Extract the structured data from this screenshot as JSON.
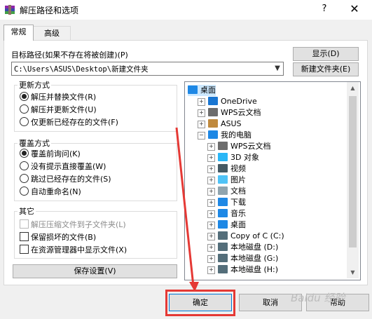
{
  "window": {
    "title": "解压路径和选项",
    "help": "?",
    "close": "✕"
  },
  "tabs": [
    {
      "label": "常规",
      "active": true
    },
    {
      "label": "高级",
      "active": false
    }
  ],
  "destination": {
    "label": "目标路径(如果不存在将被创建)(P)",
    "value": "C:\\Users\\ASUS\\Desktop\\新建文件夹",
    "show_button": "显示(D)",
    "new_folder_button": "新建文件夹(E)"
  },
  "update_mode": {
    "legend": "更新方式",
    "options": [
      {
        "label": "解压并替换文件(R)",
        "selected": true
      },
      {
        "label": "解压并更新文件(U)",
        "selected": false
      },
      {
        "label": "仅更新已经存在的文件(F)",
        "selected": false
      }
    ]
  },
  "overwrite_mode": {
    "legend": "覆盖方式",
    "options": [
      {
        "label": "覆盖前询问(K)",
        "selected": true
      },
      {
        "label": "没有提示直接覆盖(W)",
        "selected": false
      },
      {
        "label": "跳过已经存在的文件(S)",
        "selected": false
      },
      {
        "label": "自动重命名(N)",
        "selected": false
      }
    ]
  },
  "misc": {
    "legend": "其它",
    "options": [
      {
        "label": "解压压缩文件到子文件夹(L)",
        "checked": false,
        "disabled": true
      },
      {
        "label": "保留损坏的文件(B)",
        "checked": false,
        "disabled": false
      },
      {
        "label": "在资源管理器中显示文件(X)",
        "checked": false,
        "disabled": false
      }
    ]
  },
  "save_settings_button": "保存设置(V)",
  "tree": [
    {
      "label": "桌面",
      "icon": "desktop-icon",
      "color": "#1e88e5",
      "expander": ""
    },
    {
      "label": "OneDrive",
      "icon": "cloud-icon",
      "color": "#1976d2",
      "expander": "+"
    },
    {
      "label": "WPS云文档",
      "icon": "cloud-icon",
      "color": "#6d6d6d",
      "expander": "+"
    },
    {
      "label": "ASUS",
      "icon": "user-icon",
      "color": "#c08a3e",
      "expander": "+"
    },
    {
      "label": "我的电脑",
      "icon": "computer-icon",
      "color": "#1e88e5",
      "expander": "−"
    },
    {
      "label": "WPS云文档",
      "icon": "cloud-icon",
      "color": "#6d6d6d",
      "expander": "+"
    },
    {
      "label": "3D 对象",
      "icon": "cube-icon",
      "color": "#29b6f6",
      "expander": "+"
    },
    {
      "label": "视频",
      "icon": "video-icon",
      "color": "#455a64",
      "expander": "+"
    },
    {
      "label": "图片",
      "icon": "pictures-icon",
      "color": "#4fc3f7",
      "expander": "+"
    },
    {
      "label": "文档",
      "icon": "documents-icon",
      "color": "#90a4ae",
      "expander": "+"
    },
    {
      "label": "下载",
      "icon": "download-icon",
      "color": "#1e88e5",
      "expander": "+"
    },
    {
      "label": "音乐",
      "icon": "music-icon",
      "color": "#1e88e5",
      "expander": "+"
    },
    {
      "label": "桌面",
      "icon": "desktop-icon",
      "color": "#1e88e5",
      "expander": "+"
    },
    {
      "label": "Copy of C (C:)",
      "icon": "drive-icon",
      "color": "#546e7a",
      "expander": "+"
    },
    {
      "label": "本地磁盘 (D:)",
      "icon": "drive-icon",
      "color": "#546e7a",
      "expander": "+"
    },
    {
      "label": "本地磁盘 (G:)",
      "icon": "drive-icon",
      "color": "#546e7a",
      "expander": "+"
    },
    {
      "label": "本地磁盘 (H:)",
      "icon": "drive-icon",
      "color": "#546e7a",
      "expander": "+"
    }
  ],
  "footer": {
    "ok": "确定",
    "cancel": "取消",
    "help": "帮助"
  },
  "watermark": "Baidu 经验",
  "accent_color": "#e53935"
}
